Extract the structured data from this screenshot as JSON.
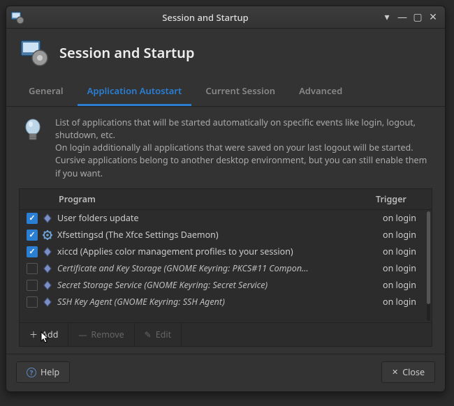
{
  "window": {
    "title": "Session and Startup"
  },
  "header": {
    "title": "Session and Startup"
  },
  "tabs": [
    {
      "label": "General",
      "active": false
    },
    {
      "label": "Application Autostart",
      "active": true
    },
    {
      "label": "Current Session",
      "active": false
    },
    {
      "label": "Advanced",
      "active": false
    }
  ],
  "info": {
    "text": "List of applications that will be started automatically on specific events like login, logout, shutdown, etc.\nOn login additionally all applications that were saved on your last logout will be started.\nCursive applications belong to another desktop environment, but you can still enable them if you want."
  },
  "list": {
    "columns": {
      "program": "Program",
      "trigger": "Trigger"
    },
    "rows": [
      {
        "checked": true,
        "icon": "diamond",
        "name": "User folders update",
        "cursive": false,
        "trigger": "on login"
      },
      {
        "checked": true,
        "icon": "gear",
        "name": "Xfsettingsd (The Xfce Settings Daemon)",
        "cursive": false,
        "trigger": "on login"
      },
      {
        "checked": true,
        "icon": "diamond",
        "name": "xiccd (Applies color management profiles to your session)",
        "cursive": false,
        "trigger": "on login"
      },
      {
        "checked": false,
        "icon": "diamond",
        "name": "Certificate and Key Storage (GNOME Keyring: PKCS#11 Compon…",
        "cursive": true,
        "trigger": "on login"
      },
      {
        "checked": false,
        "icon": "diamond",
        "name": "Secret Storage Service (GNOME Keyring: Secret Service)",
        "cursive": true,
        "trigger": "on login"
      },
      {
        "checked": false,
        "icon": "diamond",
        "name": "SSH Key Agent (GNOME Keyring: SSH Agent)",
        "cursive": true,
        "trigger": "on login"
      }
    ]
  },
  "toolbar": {
    "add": "Add",
    "remove": "Remove",
    "edit": "Edit"
  },
  "footer": {
    "help": "Help",
    "close": "Close"
  }
}
